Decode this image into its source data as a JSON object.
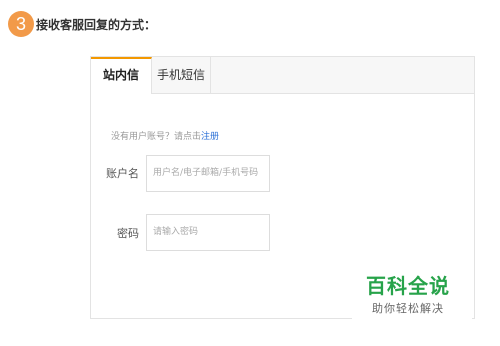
{
  "step": {
    "number": "3",
    "title": "接收客服回复的方式："
  },
  "tabs": [
    {
      "label": "站内信"
    },
    {
      "label": "手机短信"
    }
  ],
  "form": {
    "hint_prefix": "没有用户账号？请点击",
    "hint_link": "注册",
    "account": {
      "label": "账户名",
      "placeholder": "用户名/电子邮箱/手机号码"
    },
    "password": {
      "label": "密码",
      "placeholder": "请输入密码"
    }
  },
  "watermark": {
    "main": "百科全说",
    "sub": "助你轻松解决"
  },
  "colors": {
    "accent": "#f39800",
    "badge": "#f29a49",
    "link": "#2a6fd6",
    "brand": "#27a34a"
  }
}
